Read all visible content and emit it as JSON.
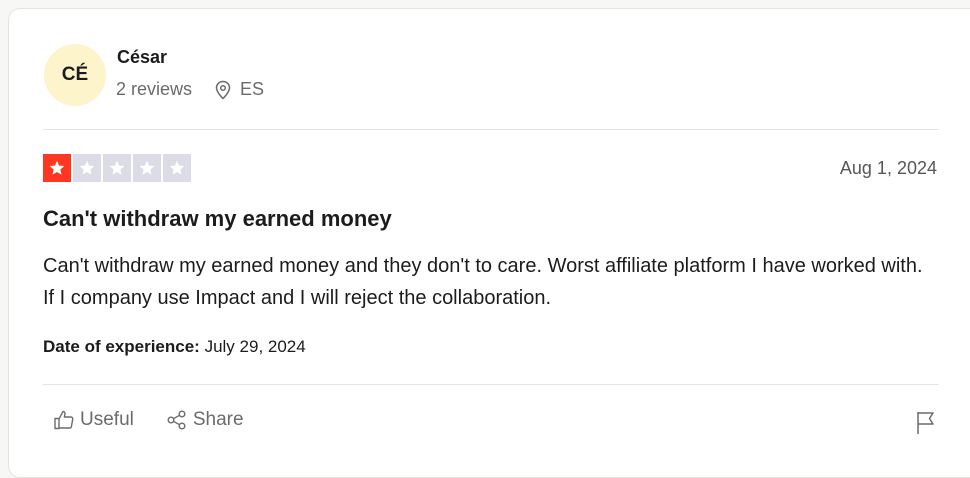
{
  "reviewer": {
    "initials": "CÉ",
    "name": "César",
    "reviews_count": "2 reviews",
    "country": "ES"
  },
  "review": {
    "rating": 1,
    "max_rating": 5,
    "date": "Aug 1, 2024",
    "title": "Can't withdraw my earned money",
    "body": "Can't withdraw my earned money and they don't to care. Worst affiliate platform I have worked with. If I company use Impact and I will reject the collaboration.",
    "experience_label": "Date of experience:",
    "experience_date": "July 29, 2024"
  },
  "actions": {
    "useful_label": "Useful",
    "share_label": "Share"
  },
  "colors": {
    "star_filled": "#ff3722",
    "star_empty": "#dcdce6",
    "avatar_bg": "#fdf4cc"
  }
}
